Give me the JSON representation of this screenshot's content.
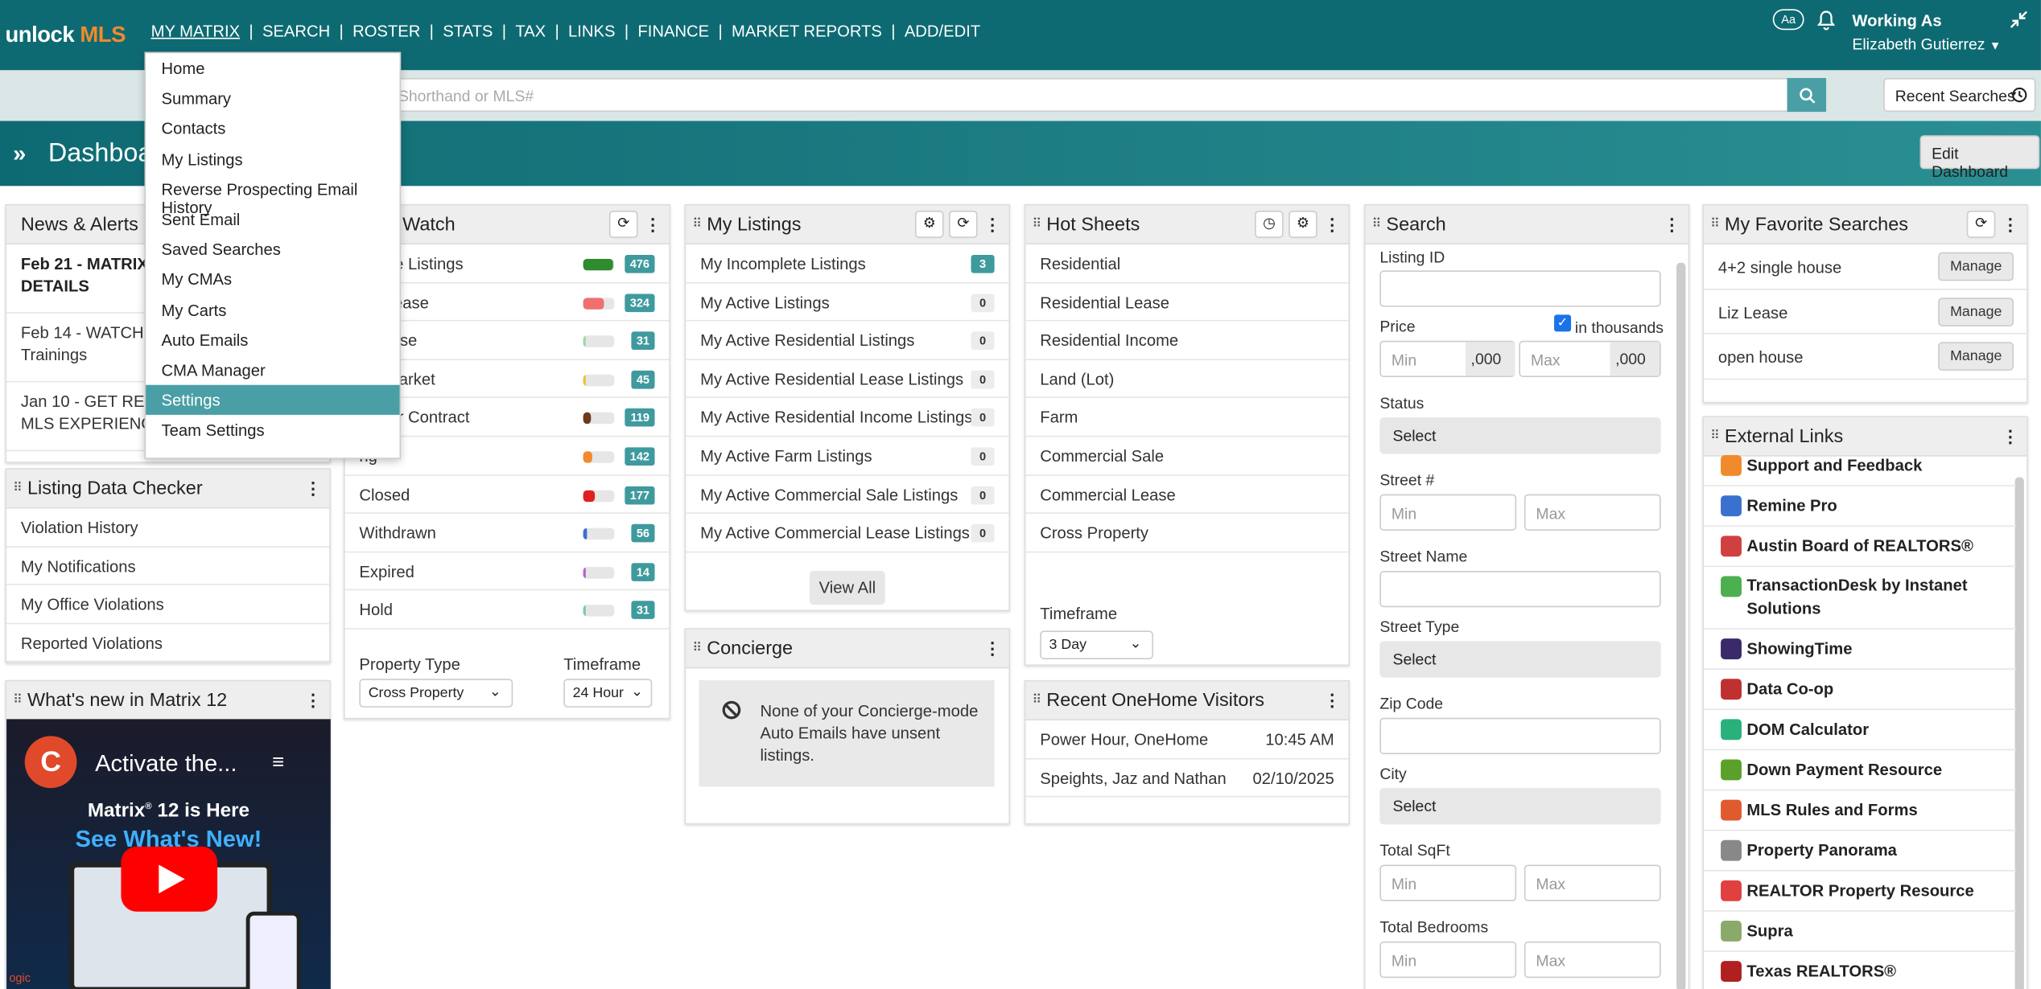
{
  "app": {
    "logo_a": "unlock",
    "logo_b": "MLS"
  },
  "nav": {
    "items": [
      "MY MATRIX",
      "SEARCH",
      "ROSTER",
      "STATS",
      "TAX",
      "LINKS",
      "FINANCE",
      "MARKET REPORTS",
      "ADD/EDIT"
    ],
    "sep": "|"
  },
  "header": {
    "aa": "Aa",
    "working_as": "Working As",
    "user": "Elizabeth Gutierrez"
  },
  "search": {
    "placeholder": "Shorthand or MLS#",
    "recent": "Recent Searches"
  },
  "dashboard": {
    "title": "Dashboard",
    "edit": "Edit Dashboard"
  },
  "dropdown": {
    "items": [
      "Home",
      "Summary",
      "Contacts",
      "My Listings",
      "Reverse Prospecting Email History",
      "Sent Email",
      "Saved Searches",
      "My CMAs",
      "My Carts",
      "Auto Emails",
      "CMA Manager",
      "Settings",
      "Team Settings"
    ],
    "selected": "Settings"
  },
  "news": {
    "title": "News & Alerts",
    "items": [
      {
        "a": "Feb 21 - MATRIX U",
        "b": "DETAILS"
      },
      {
        "a": "Feb 14 - WATCH: La",
        "b": "Trainings"
      },
      {
        "a": "Jan 10 - GET READY",
        "b": "MLS EXPERIENCE IS"
      }
    ]
  },
  "checker": {
    "title": "Listing Data Checker",
    "items": [
      "Violation History",
      "My Notifications",
      "My Office Violations",
      "Reported Violations"
    ]
  },
  "whatsnew": {
    "title": "What's new in Matrix 12",
    "video_title": "Activate the...",
    "line1": "Matrix",
    "line1b": "12 is Here",
    "line2": "See What's New!",
    "corner": "ogic"
  },
  "market": {
    "title": "rket Watch",
    "rows": [
      {
        "label": "Active Listings",
        "count": "476",
        "color": "#2e8b2e",
        "fill": 0.95
      },
      {
        "label": "Decrease",
        "count": "324",
        "color": "#f07070",
        "fill": 0.65
      },
      {
        "label": "ncrease",
        "count": "31",
        "color": "#9fd89f",
        "fill": 0.08
      },
      {
        "label": "On Market",
        "count": "45",
        "color": "#f0c030",
        "fill": 0.1
      },
      {
        "label": "Under Contract",
        "count": "119",
        "color": "#6b3a1a",
        "fill": 0.25
      },
      {
        "label": "ng",
        "count": "142",
        "color": "#f08a2c",
        "fill": 0.3
      },
      {
        "label": "Closed",
        "count": "177",
        "color": "#e02020",
        "fill": 0.37
      },
      {
        "label": "Withdrawn",
        "count": "56",
        "color": "#3a70d0",
        "fill": 0.12
      },
      {
        "label": "Expired",
        "count": "14",
        "color": "#b060d0",
        "fill": 0.04
      },
      {
        "label": "Hold",
        "count": "31",
        "color": "#7fc7a7",
        "fill": 0.08
      }
    ],
    "ptype_label": "Property Type",
    "ptype": "Cross Property",
    "tf_label": "Timeframe",
    "tf": "24 Hour"
  },
  "listings": {
    "title": "My Listings",
    "rows": [
      {
        "label": "My Incomplete Listings",
        "count": "3"
      },
      {
        "label": "My Active Listings",
        "count": "0"
      },
      {
        "label": "My Active Residential Listings",
        "count": "0"
      },
      {
        "label": "My Active Residential Lease Listings",
        "count": "0"
      },
      {
        "label": "My Active Residential Income Listings",
        "count": "0"
      },
      {
        "label": "My Active Farm Listings",
        "count": "0"
      },
      {
        "label": "My Active Commercial Sale Listings",
        "count": "0"
      },
      {
        "label": "My Active Commercial Lease Listings",
        "count": "0"
      }
    ],
    "view_all": "View All"
  },
  "concierge": {
    "title": "Concierge",
    "msg": "None of your Concierge-mode Auto Emails have unsent listings."
  },
  "hotsheets": {
    "title": "Hot Sheets",
    "rows": [
      "Residential",
      "Residential Lease",
      "Residential Income",
      "Land (Lot)",
      "Farm",
      "Commercial Sale",
      "Commercial Lease",
      "Cross Property"
    ],
    "tf_label": "Timeframe",
    "tf": "3 Day"
  },
  "visitors": {
    "title": "Recent OneHome Visitors",
    "rows": [
      {
        "name": "Power Hour, OneHome",
        "when": "10:45 AM"
      },
      {
        "name": "Speights, Jaz and Nathan",
        "when": "02/10/2025"
      }
    ]
  },
  "searchpanel": {
    "title": "Search",
    "listing_id": "Listing ID",
    "price": "Price",
    "thousands": "in thousands",
    "min": "Min",
    "max": "Max",
    "suffix": ",000",
    "status": "Status",
    "select": "Select",
    "street_no": "Street #",
    "street_name": "Street Name",
    "street_type": "Street Type",
    "zip": "Zip Code",
    "city": "City",
    "sqft": "Total SqFt",
    "beds": "Total Bedrooms"
  },
  "favorites": {
    "title": "My Favorite Searches",
    "manage": "Manage",
    "rows": [
      "4+2 single house",
      "Liz Lease",
      "open house"
    ]
  },
  "links": {
    "title": "External Links",
    "rows": [
      {
        "label": "Support and Feedback",
        "color": "#f08a2c"
      },
      {
        "label": "Remine Pro",
        "color": "#3a70d0"
      },
      {
        "label": "Austin Board of REALTORS®",
        "color": "#d04040"
      },
      {
        "label": "TransactionDesk by Instanet Solutions",
        "color": "#4caf50"
      },
      {
        "label": "ShowingTime",
        "color": "#3a2a6a"
      },
      {
        "label": "Data Co-op",
        "color": "#c03030"
      },
      {
        "label": "DOM Calculator",
        "color": "#2ab07a"
      },
      {
        "label": "Down Payment Resource",
        "color": "#5aa02a"
      },
      {
        "label": "MLS Rules and Forms",
        "color": "#e05a30"
      },
      {
        "label": "Property Panorama",
        "color": "#888888"
      },
      {
        "label": "REALTOR Property Resource",
        "color": "#e04040"
      },
      {
        "label": "Supra",
        "color": "#8aaa6a"
      },
      {
        "label": "Texas REALTORS®",
        "color": "#b02020"
      }
    ]
  }
}
